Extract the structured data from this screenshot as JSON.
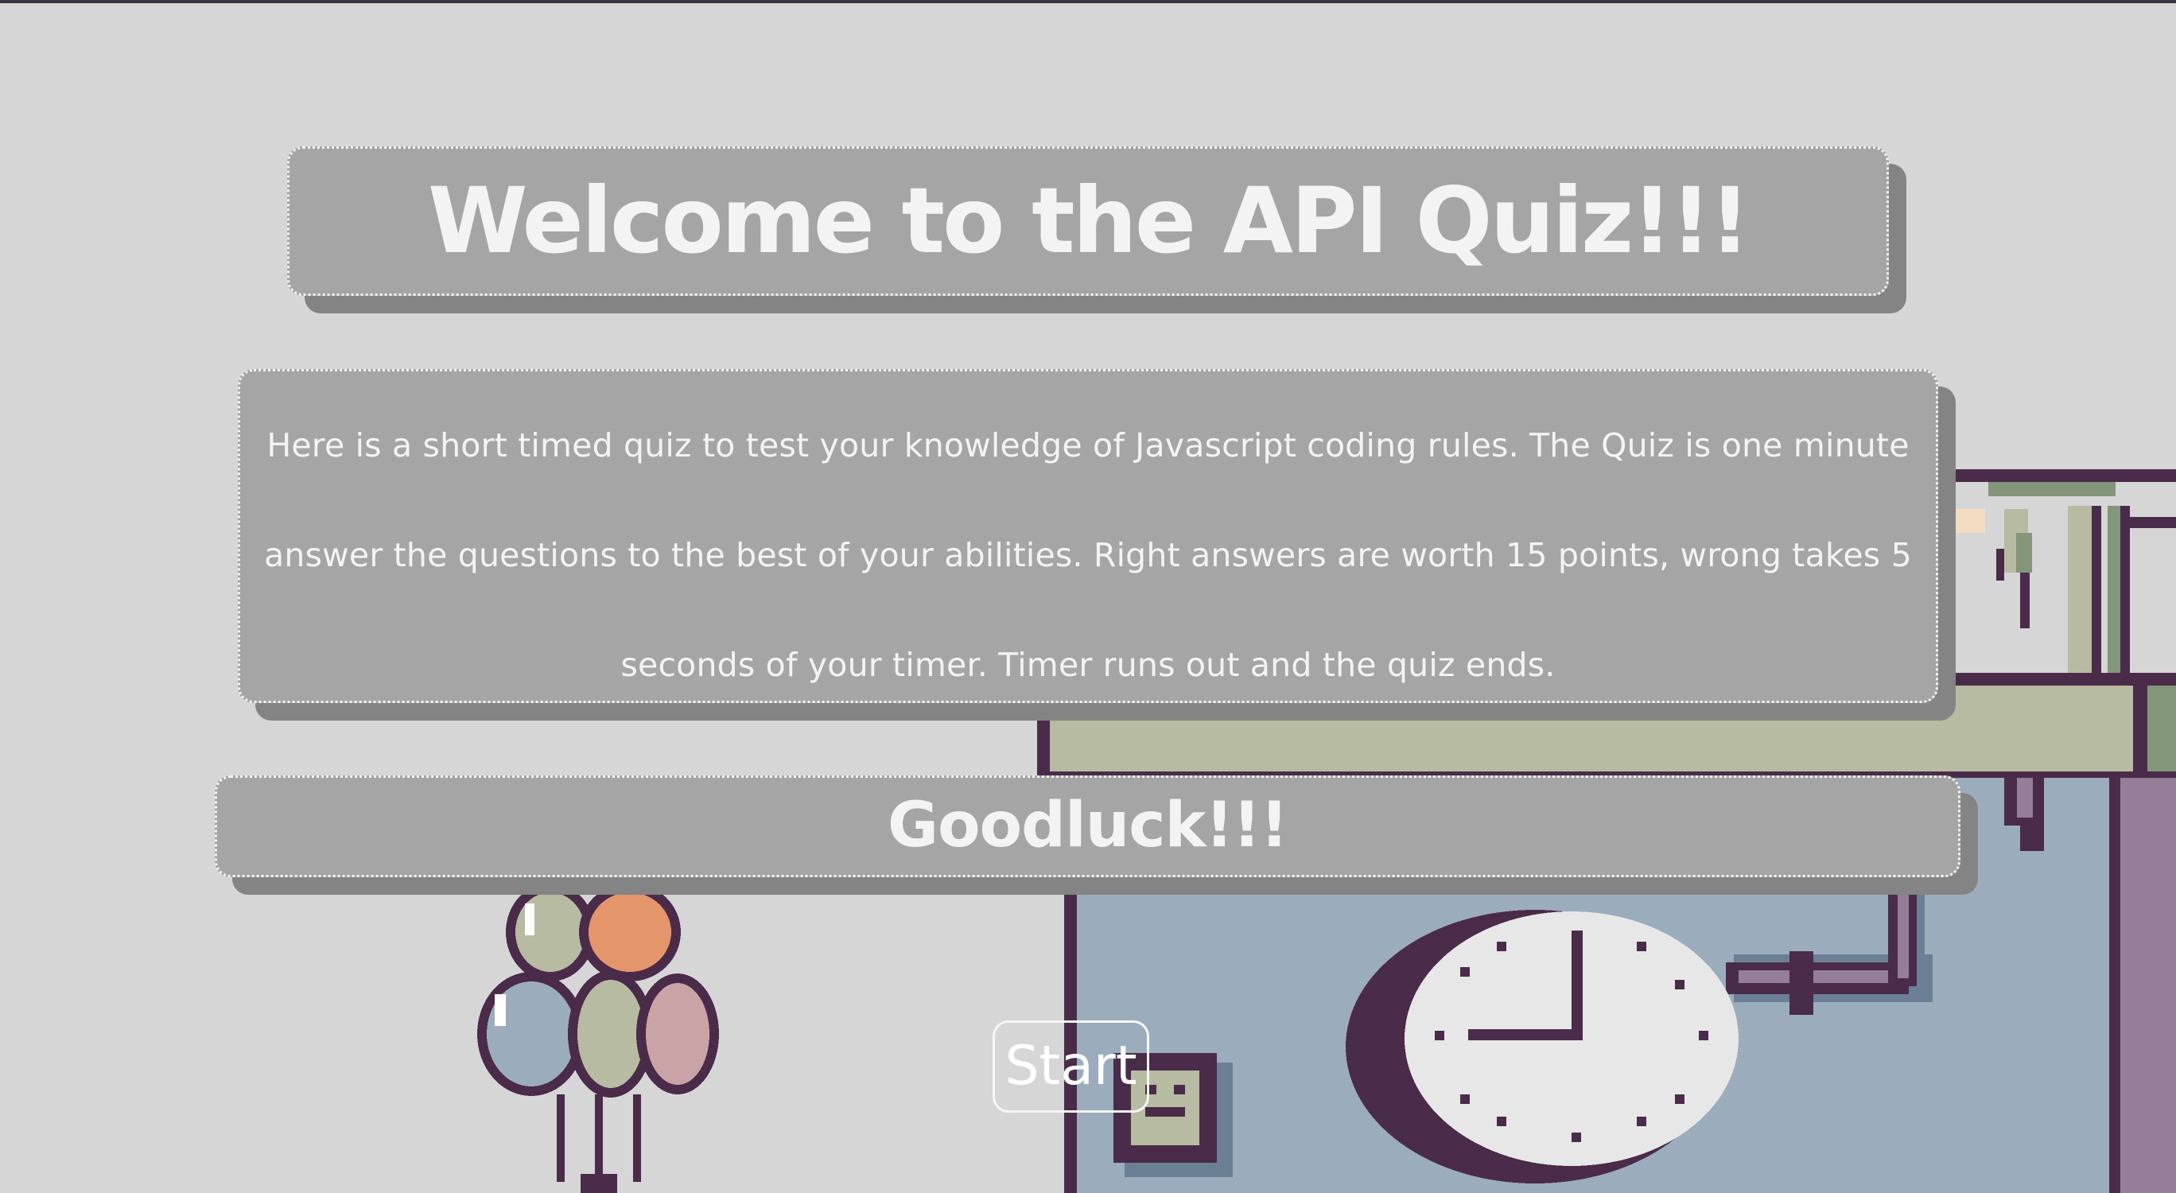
{
  "quiz": {
    "title": "Welcome to the API Quiz!!!",
    "description": "Here is a short timed quiz to test your knowledge of Javascript coding rules. The Quiz is one minute answer the questions to the best of your abilities. Right answers are worth 15 points, wrong takes 5 seconds of your timer. Timer runs out and the quiz ends.",
    "goodluck": "Goodluck!!!",
    "start_label": "Start"
  },
  "colors": {
    "background": "#d6d6d6",
    "panel": "#a5a5a5",
    "panel_shadow": "#848484",
    "text": "#f3f3f3",
    "pixel_outline": "#4a2c4a",
    "wall_green": "#b6bba2",
    "wall_blue": "#9bacbc",
    "wall_mauve": "#957e98",
    "balloon_orange": "#e4956a",
    "balloon_pink": "#caa3a7"
  },
  "icons": {
    "background_art": "pixel-art-room-with-balloons-and-wall-clock",
    "clock": "clock-icon",
    "balloons": "balloons-icon"
  }
}
